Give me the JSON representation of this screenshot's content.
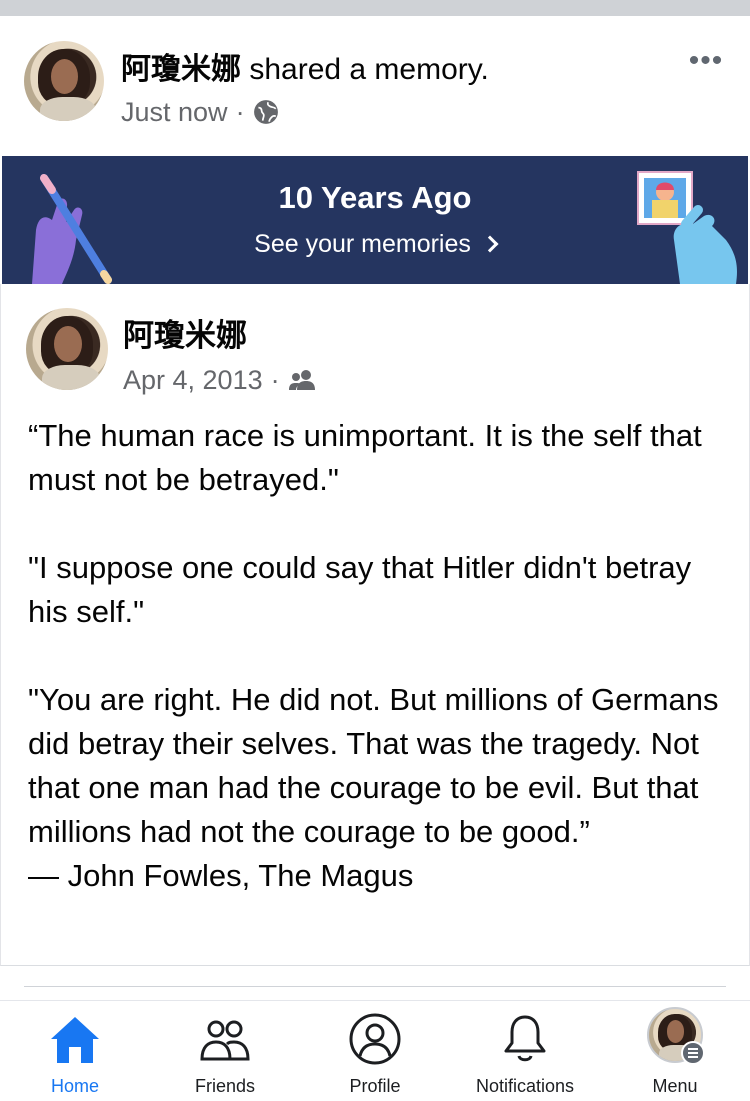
{
  "post": {
    "author": "阿瓊米娜",
    "action": "shared a memory.",
    "time": "Just now",
    "separator": "·",
    "privacy_icon": "globe-icon",
    "more_icon": "more-icon"
  },
  "memories_banner": {
    "title": "10 Years Ago",
    "link": "See your memories"
  },
  "memory_post": {
    "author": "阿瓊米娜",
    "date": "Apr 4, 2013",
    "separator": "·",
    "audience_icon": "friends-icon",
    "paragraphs": [
      "“The human race is unimportant. It is the self that must not be betrayed.\"",
      "\"I suppose one could say that Hitler didn't betray his self.\"",
      "\"You are right. He did not. But millions of Germans did betray their selves. That was the tragedy. Not that one man had the courage to be evil. But that millions had not the courage to be good.”",
      "— John Fowles, The Magus"
    ]
  },
  "bottom_nav": {
    "items": [
      {
        "label": "Home",
        "icon": "home-icon",
        "active": true
      },
      {
        "label": "Friends",
        "icon": "friends-icon",
        "active": false
      },
      {
        "label": "Profile",
        "icon": "profile-icon",
        "active": false
      },
      {
        "label": "Notifications",
        "icon": "bell-icon",
        "active": false
      },
      {
        "label": "Menu",
        "icon": "avatar-menu-icon",
        "active": false
      }
    ]
  },
  "colors": {
    "accent": "#1877f2",
    "banner_bg": "#253560",
    "secondary_text": "#65676b"
  }
}
